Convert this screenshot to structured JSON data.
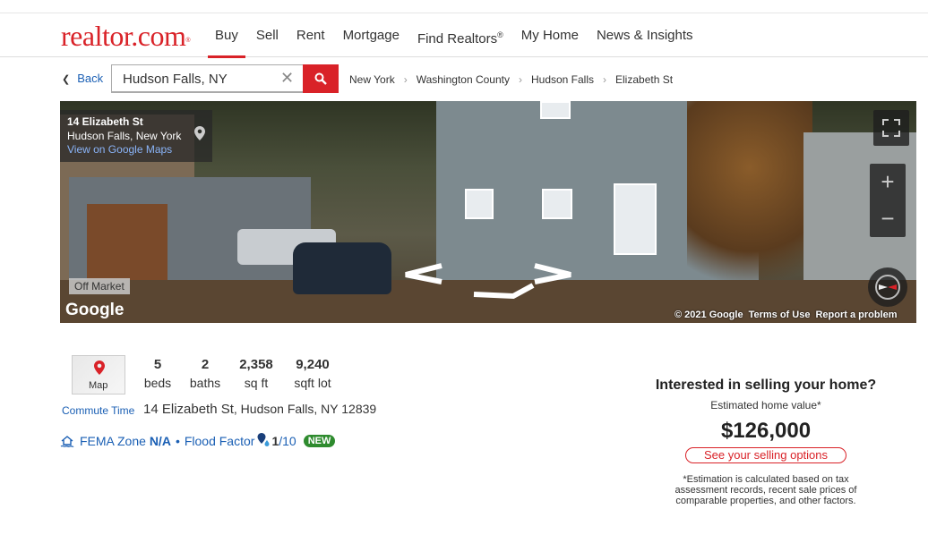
{
  "logo": {
    "text": "realtor.com",
    "mark": "®"
  },
  "nav": {
    "items": [
      "Buy",
      "Sell",
      "Rent",
      "Mortgage",
      "Find Realtors",
      "My Home",
      "News & Insights"
    ],
    "find_realtors_mark": "®",
    "active": "Buy"
  },
  "search": {
    "back_label": "Back",
    "value": "Hudson Falls, NY",
    "clear_icon": "close-icon",
    "submit_icon": "search-icon"
  },
  "breadcrumbs": [
    "New York",
    "Washington County",
    "Hudson Falls",
    "Elizabeth St"
  ],
  "street_view": {
    "street": "14 Elizabeth St",
    "city": "Hudson Falls, New York",
    "link": "View on Google Maps",
    "status": "Off Market",
    "provider": "Google",
    "copyright": "© 2021 Google",
    "terms": "Terms of Use",
    "report": "Report a problem",
    "zoom_in": "+",
    "zoom_out": "−"
  },
  "property": {
    "map_label": "Map",
    "commute_label": "Commute Time",
    "beds": "5",
    "beds_label": "beds",
    "baths": "2",
    "baths_label": "baths",
    "sqft": "2,358",
    "sqft_label": "sq ft",
    "lot": "9,240",
    "lot_label": "sqft lot",
    "street": "14 Elizabeth St",
    "city": ", Hudson Falls, NY 12839",
    "fema_label": "FEMA Zone",
    "fema_value": "N/A",
    "bullet": "•",
    "flood_label": "Flood Factor",
    "flood_value": "1",
    "flood_total": "/10",
    "new_badge": "NEW"
  },
  "selling": {
    "title": "Interested in selling your home?",
    "subtitle": "Estimated home value*",
    "price": "$126,000",
    "cta": "See your selling options",
    "note": "*Estimation is calculated based on tax assessment records, recent sale prices of comparable properties, and other factors."
  },
  "colors": {
    "brand": "#d92228",
    "link": "#1a5fb4",
    "badge": "#2e8b2e"
  }
}
